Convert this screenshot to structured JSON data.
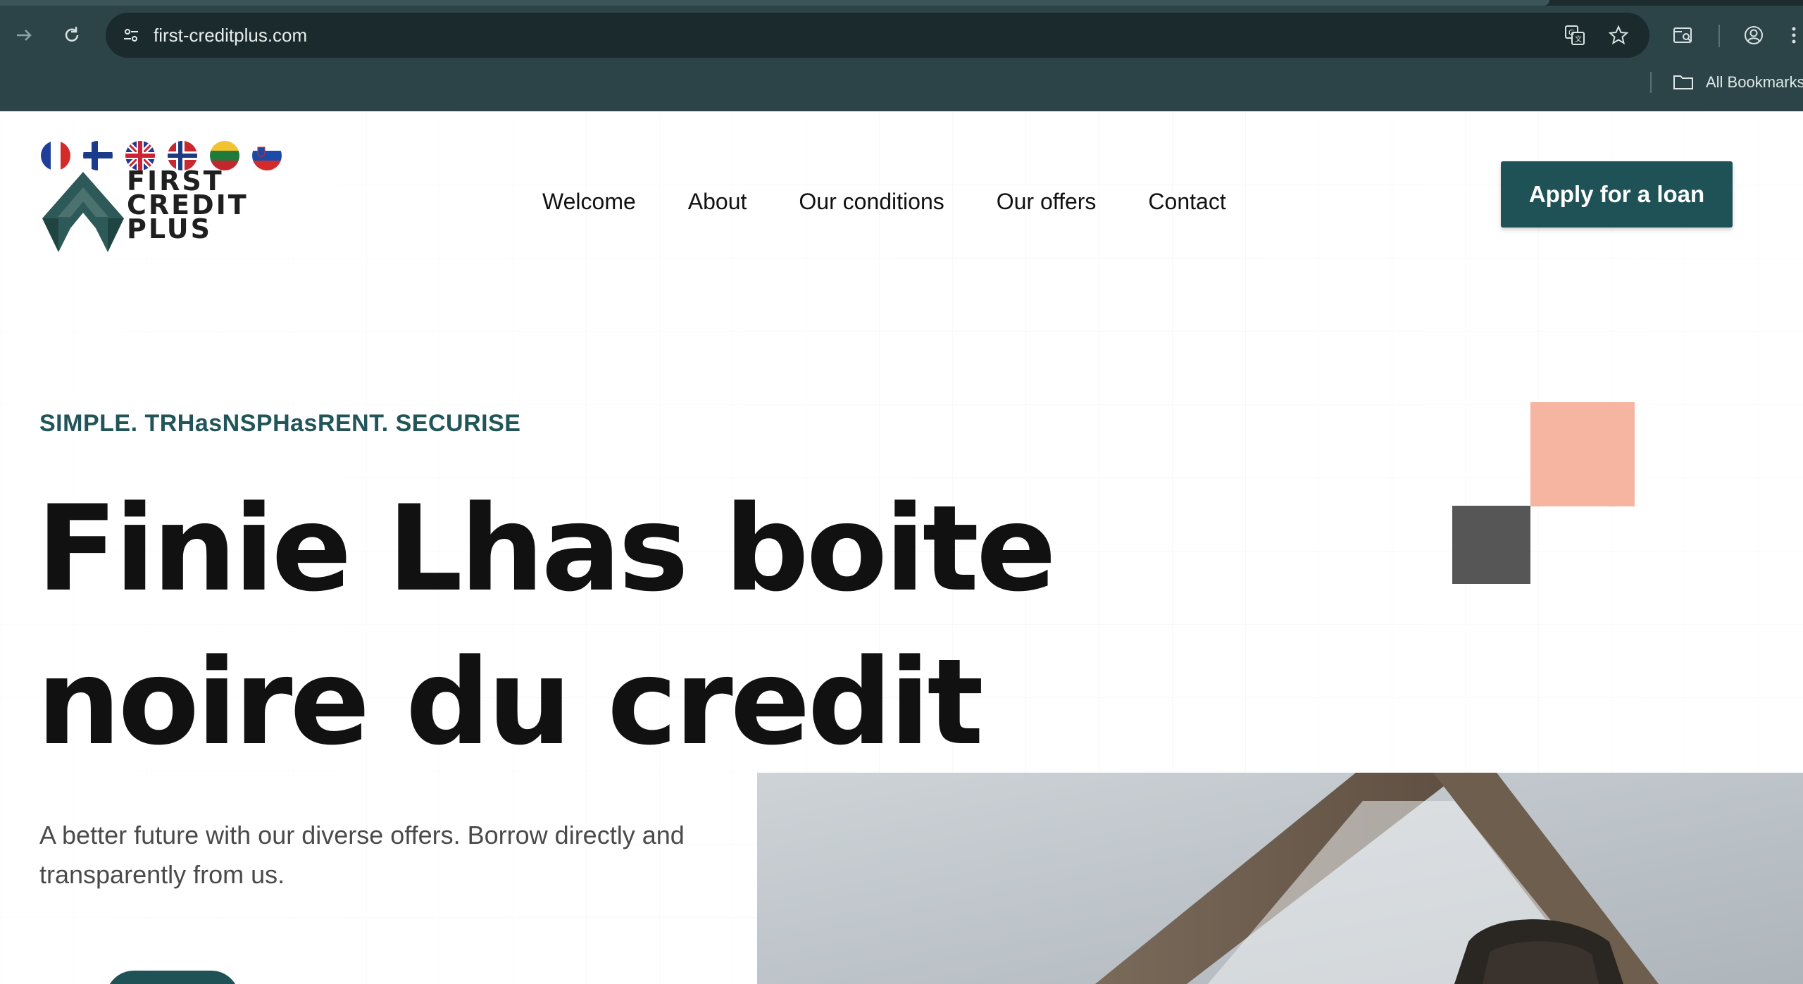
{
  "browser": {
    "url": "first-creditplus.com",
    "bookmarks_label": "All Bookmarks",
    "icons": [
      "forward-icon",
      "reload-icon",
      "site-settings-icon",
      "translate-icon",
      "star-icon",
      "tab-search-icon",
      "profile-icon",
      "menu-icon",
      "folder-icon"
    ]
  },
  "site": {
    "logo": {
      "line1": "FIRST",
      "line2": "CREDIT",
      "line3": "PLUS"
    },
    "languages": [
      "fr",
      "fi",
      "gb",
      "no",
      "lt",
      "si"
    ],
    "nav": [
      {
        "label": "Welcome"
      },
      {
        "label": "About"
      },
      {
        "label": "Our conditions"
      },
      {
        "label": "Our offers"
      },
      {
        "label": "Contact"
      }
    ],
    "cta_label": "Apply for a loan"
  },
  "hero": {
    "tagline": "SIMPLE. TRHasNSPHasRENT. SECURISE",
    "headline_line1": "Finie Lhas boite",
    "headline_line2": "noire du credit",
    "subtext": "A better future with our diverse offers. Borrow directly and transparently from us."
  },
  "colors": {
    "brand_dark_green": "#1f5256",
    "salmon": "#f5b5a0",
    "dark_gray": "#565656",
    "chrome_bg": "#2c4447"
  }
}
